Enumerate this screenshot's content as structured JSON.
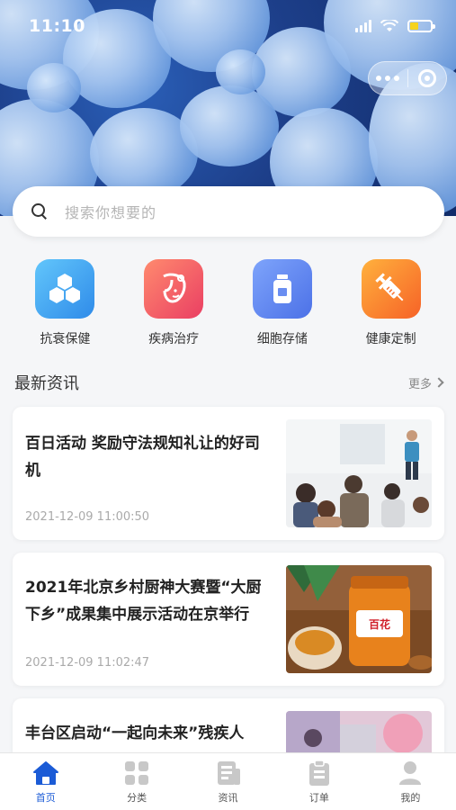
{
  "status_bar": {
    "time": "11:10"
  },
  "search": {
    "placeholder": "搜索你想要的"
  },
  "categories": [
    {
      "label": "抗衰保健",
      "icon": "cubes-icon",
      "color": "#3aa3f2"
    },
    {
      "label": "疾病治疗",
      "icon": "face-icon",
      "color": "#f2586a"
    },
    {
      "label": "细胞存储",
      "icon": "bottle-icon",
      "color": "#5f87ee"
    },
    {
      "label": "健康定制",
      "icon": "syringe-icon",
      "color": "#f7722f"
    }
  ],
  "news": {
    "title": "最新资讯",
    "more_label": "更多",
    "items": [
      {
        "title": "百日活动 奖励守法规知礼让的好司机",
        "date": "2021-12-09 11:00:50"
      },
      {
        "title": "2021年北京乡村厨神大赛暨“大厨下乡”成果集中展示活动在京举行",
        "date": "2021-12-09 11:02:47"
      },
      {
        "title": "丰台区启动“一起向未来”残疾人",
        "date": ""
      }
    ]
  },
  "tabbar": [
    {
      "label": "首页",
      "icon": "home-icon",
      "active": true
    },
    {
      "label": "分类",
      "icon": "grid-icon",
      "active": false
    },
    {
      "label": "资讯",
      "icon": "news-icon",
      "active": false
    },
    {
      "label": "订单",
      "icon": "clipboard-icon",
      "active": false
    },
    {
      "label": "我的",
      "icon": "user-icon",
      "active": false
    }
  ],
  "colors": {
    "accent": "#1b5bd6",
    "tab_inactive": "#c8c8c8"
  }
}
